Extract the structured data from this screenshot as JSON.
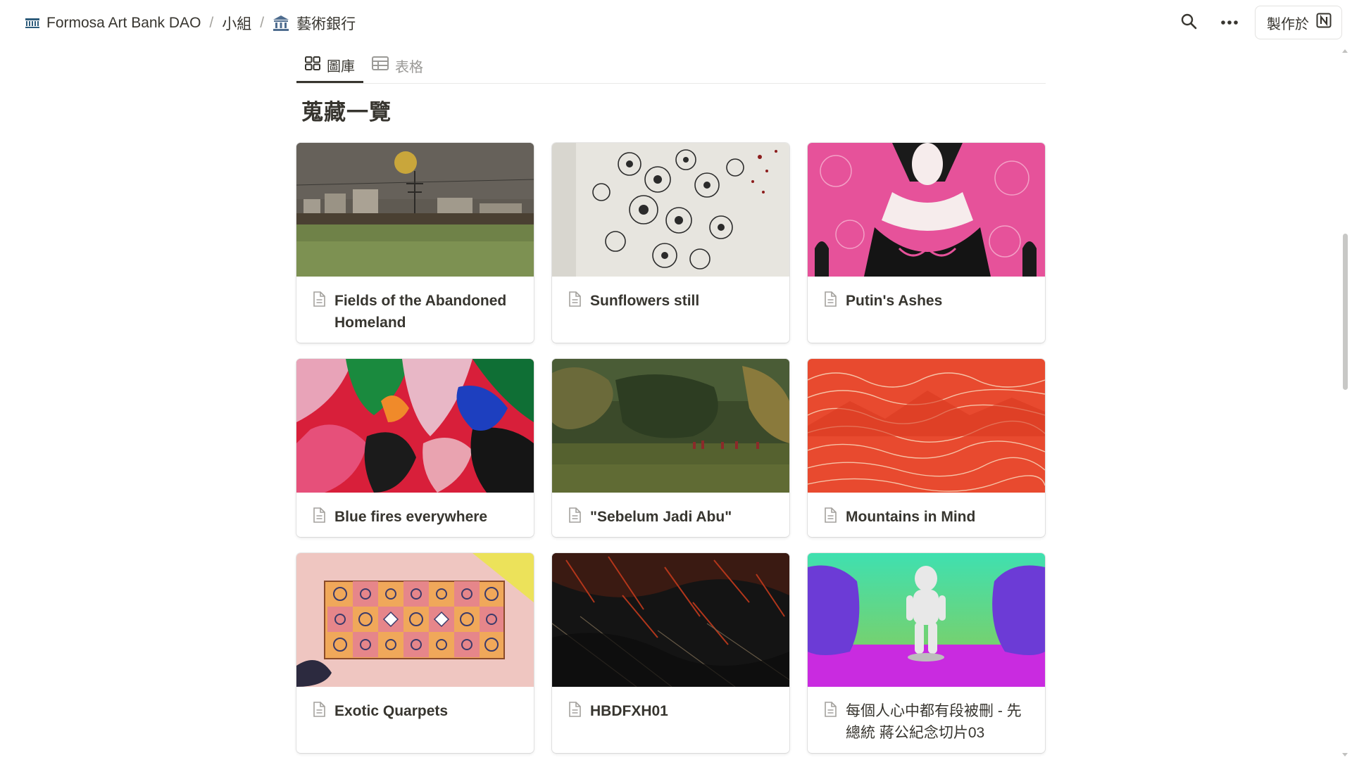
{
  "breadcrumb": {
    "org": "Formosa Art Bank DAO",
    "group": "小組",
    "page": "藝術銀行",
    "separator": "/"
  },
  "topbar": {
    "made_with": "製作於",
    "search_icon": "search-icon",
    "more_icon": "more-icon"
  },
  "tabs": [
    {
      "label": "圖庫",
      "icon": "gallery-icon",
      "active": true
    },
    {
      "label": "表格",
      "icon": "table-icon",
      "active": false
    }
  ],
  "heading": "蒐藏一覽",
  "cards": [
    {
      "title": "Fields of the Abandoned Homeland"
    },
    {
      "title": "Sunflowers still"
    },
    {
      "title": "Putin's Ashes"
    },
    {
      "title": "Blue fires everywhere"
    },
    {
      "title": "\"Sebelum Jadi Abu\""
    },
    {
      "title": "Mountains in Mind"
    },
    {
      "title": "Exotic Quarpets"
    },
    {
      "title": "HBDFXH01"
    },
    {
      "title": "每個人心中都有段被刪 - 先總統 蔣公紀念切片03"
    }
  ],
  "colors": {
    "text": "#37352f",
    "muted": "#9b9a97",
    "breadcrumb_icon": "#4f6d8f"
  }
}
